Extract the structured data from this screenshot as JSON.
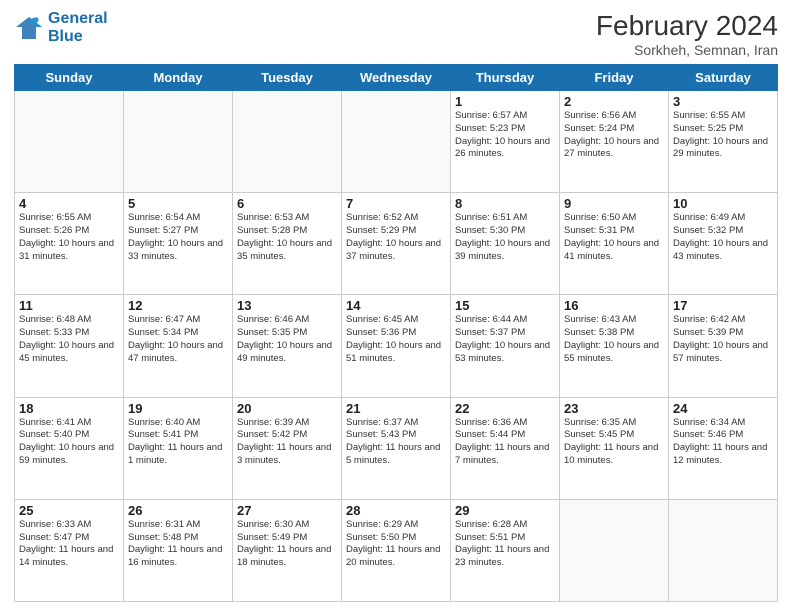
{
  "header": {
    "logo_line1": "General",
    "logo_line2": "Blue",
    "month_year": "February 2024",
    "subtitle": "Sorkheh, Semnan, Iran"
  },
  "days_of_week": [
    "Sunday",
    "Monday",
    "Tuesday",
    "Wednesday",
    "Thursday",
    "Friday",
    "Saturday"
  ],
  "weeks": [
    [
      {
        "day": "",
        "info": ""
      },
      {
        "day": "",
        "info": ""
      },
      {
        "day": "",
        "info": ""
      },
      {
        "day": "",
        "info": ""
      },
      {
        "day": "1",
        "info": "Sunrise: 6:57 AM\nSunset: 5:23 PM\nDaylight: 10 hours and 26 minutes."
      },
      {
        "day": "2",
        "info": "Sunrise: 6:56 AM\nSunset: 5:24 PM\nDaylight: 10 hours and 27 minutes."
      },
      {
        "day": "3",
        "info": "Sunrise: 6:55 AM\nSunset: 5:25 PM\nDaylight: 10 hours and 29 minutes."
      }
    ],
    [
      {
        "day": "4",
        "info": "Sunrise: 6:55 AM\nSunset: 5:26 PM\nDaylight: 10 hours and 31 minutes."
      },
      {
        "day": "5",
        "info": "Sunrise: 6:54 AM\nSunset: 5:27 PM\nDaylight: 10 hours and 33 minutes."
      },
      {
        "day": "6",
        "info": "Sunrise: 6:53 AM\nSunset: 5:28 PM\nDaylight: 10 hours and 35 minutes."
      },
      {
        "day": "7",
        "info": "Sunrise: 6:52 AM\nSunset: 5:29 PM\nDaylight: 10 hours and 37 minutes."
      },
      {
        "day": "8",
        "info": "Sunrise: 6:51 AM\nSunset: 5:30 PM\nDaylight: 10 hours and 39 minutes."
      },
      {
        "day": "9",
        "info": "Sunrise: 6:50 AM\nSunset: 5:31 PM\nDaylight: 10 hours and 41 minutes."
      },
      {
        "day": "10",
        "info": "Sunrise: 6:49 AM\nSunset: 5:32 PM\nDaylight: 10 hours and 43 minutes."
      }
    ],
    [
      {
        "day": "11",
        "info": "Sunrise: 6:48 AM\nSunset: 5:33 PM\nDaylight: 10 hours and 45 minutes."
      },
      {
        "day": "12",
        "info": "Sunrise: 6:47 AM\nSunset: 5:34 PM\nDaylight: 10 hours and 47 minutes."
      },
      {
        "day": "13",
        "info": "Sunrise: 6:46 AM\nSunset: 5:35 PM\nDaylight: 10 hours and 49 minutes."
      },
      {
        "day": "14",
        "info": "Sunrise: 6:45 AM\nSunset: 5:36 PM\nDaylight: 10 hours and 51 minutes."
      },
      {
        "day": "15",
        "info": "Sunrise: 6:44 AM\nSunset: 5:37 PM\nDaylight: 10 hours and 53 minutes."
      },
      {
        "day": "16",
        "info": "Sunrise: 6:43 AM\nSunset: 5:38 PM\nDaylight: 10 hours and 55 minutes."
      },
      {
        "day": "17",
        "info": "Sunrise: 6:42 AM\nSunset: 5:39 PM\nDaylight: 10 hours and 57 minutes."
      }
    ],
    [
      {
        "day": "18",
        "info": "Sunrise: 6:41 AM\nSunset: 5:40 PM\nDaylight: 10 hours and 59 minutes."
      },
      {
        "day": "19",
        "info": "Sunrise: 6:40 AM\nSunset: 5:41 PM\nDaylight: 11 hours and 1 minute."
      },
      {
        "day": "20",
        "info": "Sunrise: 6:39 AM\nSunset: 5:42 PM\nDaylight: 11 hours and 3 minutes."
      },
      {
        "day": "21",
        "info": "Sunrise: 6:37 AM\nSunset: 5:43 PM\nDaylight: 11 hours and 5 minutes."
      },
      {
        "day": "22",
        "info": "Sunrise: 6:36 AM\nSunset: 5:44 PM\nDaylight: 11 hours and 7 minutes."
      },
      {
        "day": "23",
        "info": "Sunrise: 6:35 AM\nSunset: 5:45 PM\nDaylight: 11 hours and 10 minutes."
      },
      {
        "day": "24",
        "info": "Sunrise: 6:34 AM\nSunset: 5:46 PM\nDaylight: 11 hours and 12 minutes."
      }
    ],
    [
      {
        "day": "25",
        "info": "Sunrise: 6:33 AM\nSunset: 5:47 PM\nDaylight: 11 hours and 14 minutes."
      },
      {
        "day": "26",
        "info": "Sunrise: 6:31 AM\nSunset: 5:48 PM\nDaylight: 11 hours and 16 minutes."
      },
      {
        "day": "27",
        "info": "Sunrise: 6:30 AM\nSunset: 5:49 PM\nDaylight: 11 hours and 18 minutes."
      },
      {
        "day": "28",
        "info": "Sunrise: 6:29 AM\nSunset: 5:50 PM\nDaylight: 11 hours and 20 minutes."
      },
      {
        "day": "29",
        "info": "Sunrise: 6:28 AM\nSunset: 5:51 PM\nDaylight: 11 hours and 23 minutes."
      },
      {
        "day": "",
        "info": ""
      },
      {
        "day": "",
        "info": ""
      }
    ]
  ]
}
